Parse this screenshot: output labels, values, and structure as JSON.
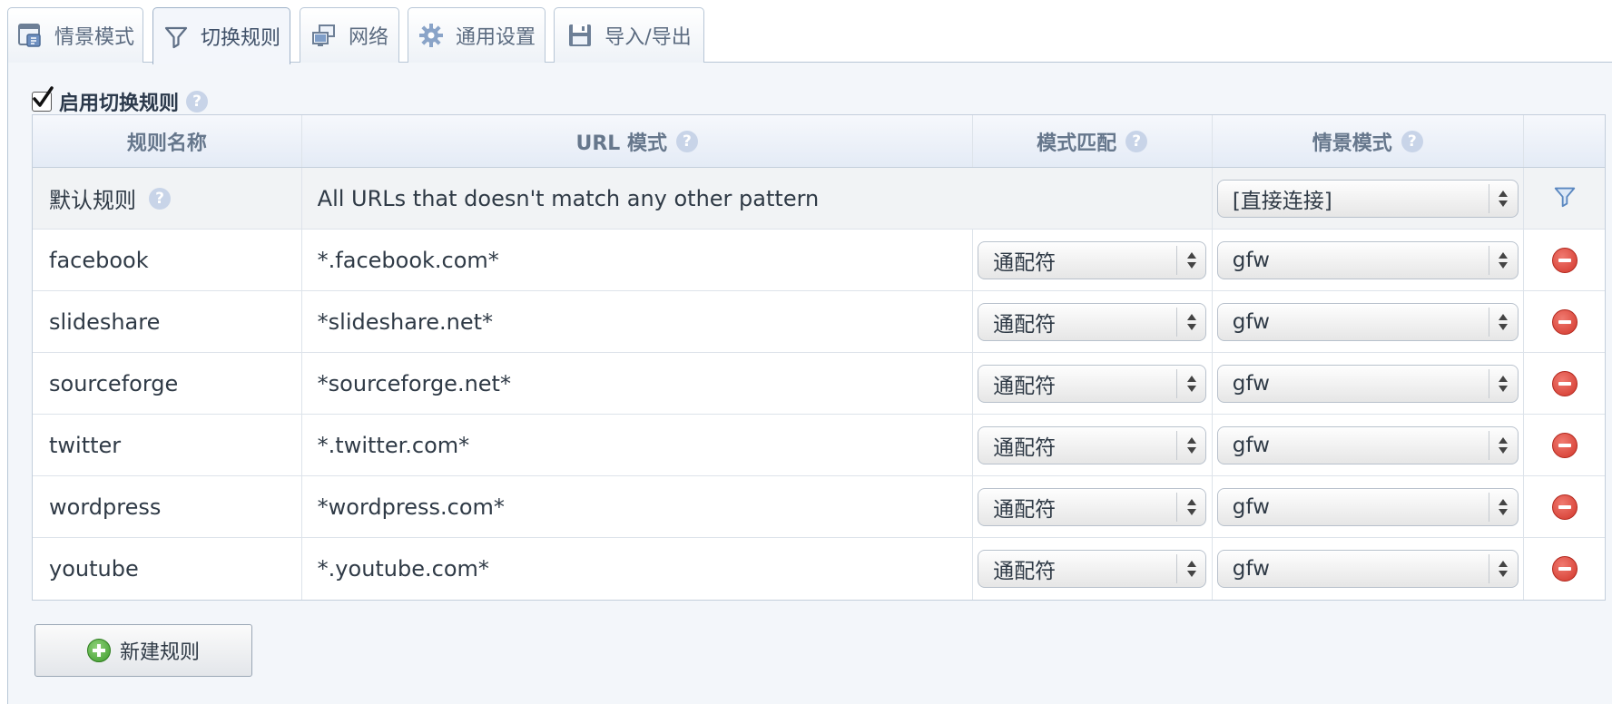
{
  "tabs": [
    {
      "label": "情景模式",
      "icon": "profiles-icon",
      "active": false
    },
    {
      "label": "切换规则",
      "icon": "filter-icon",
      "active": true
    },
    {
      "label": "网络",
      "icon": "network-icon",
      "active": false
    },
    {
      "label": "通用设置",
      "icon": "gear-icon",
      "active": false
    },
    {
      "label": "导入/导出",
      "icon": "save-icon",
      "active": false
    }
  ],
  "enable": {
    "label": "启用切换规则",
    "checked": true
  },
  "table": {
    "headers": {
      "name": "规则名称",
      "url": "URL 模式",
      "match": "模式匹配",
      "profile": "情景模式"
    },
    "default_rule": {
      "name": "默认规则",
      "url": "All URLs that doesn't match any other pattern",
      "profile": "[直接连接]"
    },
    "rules": [
      {
        "name": "facebook",
        "url": "*.facebook.com*",
        "match": "通配符",
        "profile": "gfw"
      },
      {
        "name": "slideshare",
        "url": "*slideshare.net*",
        "match": "通配符",
        "profile": "gfw"
      },
      {
        "name": "sourceforge",
        "url": "*sourceforge.net*",
        "match": "通配符",
        "profile": "gfw"
      },
      {
        "name": "twitter",
        "url": "*.twitter.com*",
        "match": "通配符",
        "profile": "gfw"
      },
      {
        "name": "wordpress",
        "url": "*wordpress.com*",
        "match": "通配符",
        "profile": "gfw"
      },
      {
        "name": "youtube",
        "url": "*.youtube.com*",
        "match": "通配符",
        "profile": "gfw"
      }
    ]
  },
  "new_rule_label": "新建规则",
  "colors": {
    "accent": "#5b6b80",
    "delete": "#d2362b",
    "add": "#3d9b2b"
  }
}
